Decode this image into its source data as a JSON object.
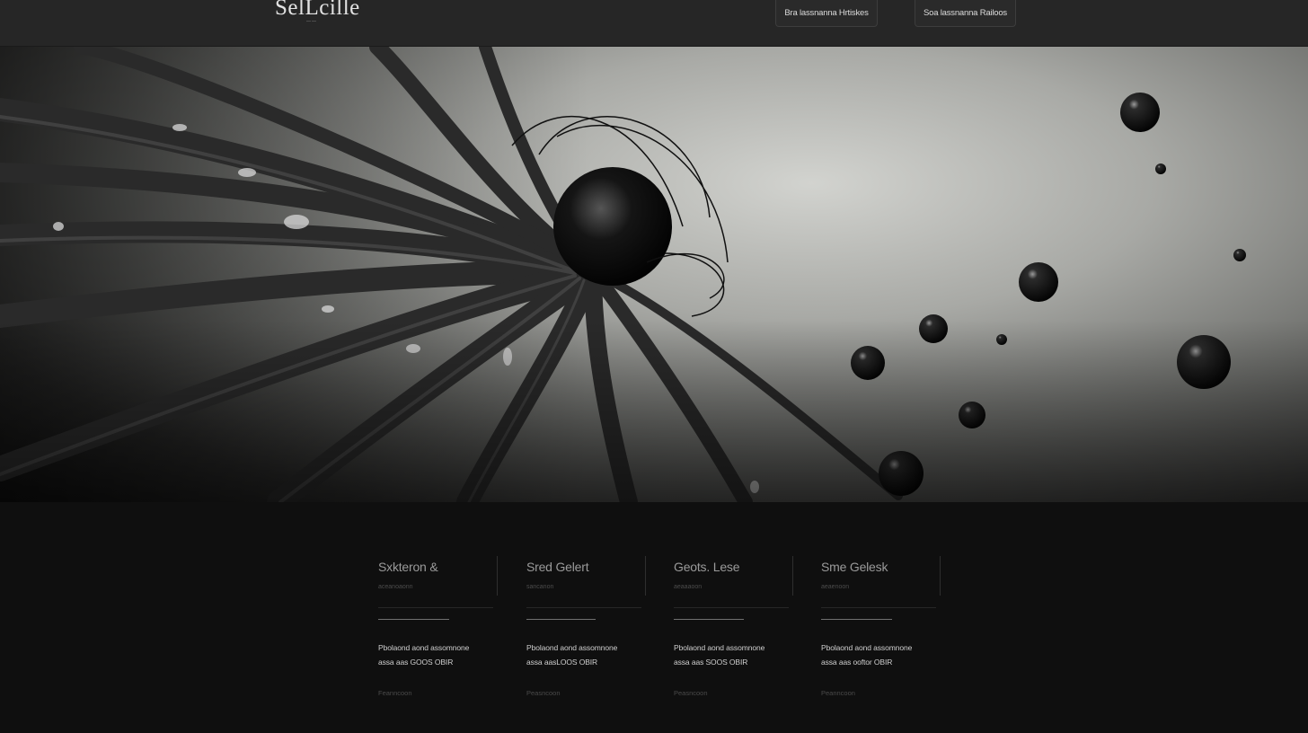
{
  "header": {
    "logo": "SelLcille",
    "logo_tagline": "——",
    "nav": [
      {
        "label": "Bra lassnanna Hrtiskes"
      },
      {
        "label": "Soa lassnanna Railoos"
      }
    ]
  },
  "hero": {
    "image": "spiky-sea-creature-with-droplets",
    "palette": "monochrome"
  },
  "cards": [
    {
      "title": "Sxkteron &",
      "subtitle": "aceanoaonn",
      "body_line1": "Pbolaond aond assomnone",
      "body_line2": "assa aas GOOS OBIR",
      "link": "Feanncoon"
    },
    {
      "title": "Sred Gelert",
      "subtitle": "sancanon",
      "body_line1": "Pbolaond aond assomnone",
      "body_line2": "assa aasLOOS OBIR",
      "link": "Peasncoon"
    },
    {
      "title": "Geots. Lese",
      "subtitle": "aeaaaoon",
      "body_line1": "Pbolaond aond assomnone",
      "body_line2": "assa aas SOOS OBIR",
      "link": "Peasncoon"
    },
    {
      "title": "Sme Gelesk",
      "subtitle": "aeaenoon",
      "body_line1": "Pbolaond aond assomnone",
      "body_line2": "assa aas ooftor OBIR",
      "link": "Peanncoon"
    }
  ],
  "colors": {
    "header_bg": "#262626",
    "page_bg": "#0f0f0f",
    "text_light": "#cfcfcf"
  }
}
